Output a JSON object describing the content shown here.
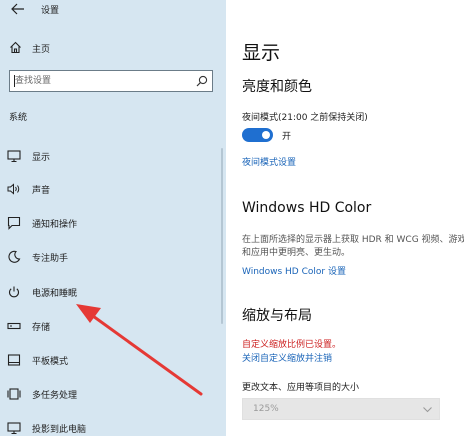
{
  "app": {
    "title": "设置"
  },
  "sidebar": {
    "home_label": "主页",
    "search": {
      "placeholder": "查找设置",
      "value": ""
    },
    "section_label": "系统",
    "items": [
      {
        "label": "显示",
        "icon": "monitor-icon"
      },
      {
        "label": "声音",
        "icon": "speaker-icon"
      },
      {
        "label": "通知和操作",
        "icon": "notification-icon"
      },
      {
        "label": "专注助手",
        "icon": "moon-icon"
      },
      {
        "label": "电源和睡眠",
        "icon": "power-icon"
      },
      {
        "label": "存储",
        "icon": "storage-icon"
      },
      {
        "label": "平板模式",
        "icon": "tablet-icon"
      },
      {
        "label": "多任务处理",
        "icon": "multitask-icon"
      },
      {
        "label": "投影到此电脑",
        "icon": "projector-icon"
      }
    ]
  },
  "content": {
    "page_title": "显示",
    "brightness": {
      "heading": "亮度和颜色",
      "night_light_label": "夜间模式(21:00 之前保持关闭)",
      "toggle_state": "开",
      "night_light_link": "夜间模式设置"
    },
    "hdr": {
      "heading": "Windows HD Color",
      "description": "在上面所选择的显示器上获取 HDR 和 WCG 视频、游戏和应用中更明亮、更生动。",
      "link": "Windows HD Color 设置"
    },
    "scale": {
      "heading": "缩放与布局",
      "warning": "自定义缩放比例已设置。",
      "off_link": "关闭自定义缩放并注销",
      "size_label": "更改文本、应用等项目的大小",
      "dropdown_value": "125%"
    }
  },
  "colors": {
    "sidebar_bg": "#d6e6f1",
    "accent": "#1f6fd0",
    "link": "#1a64b8",
    "warning": "#cc1f1f",
    "arrow": "#e53935"
  }
}
